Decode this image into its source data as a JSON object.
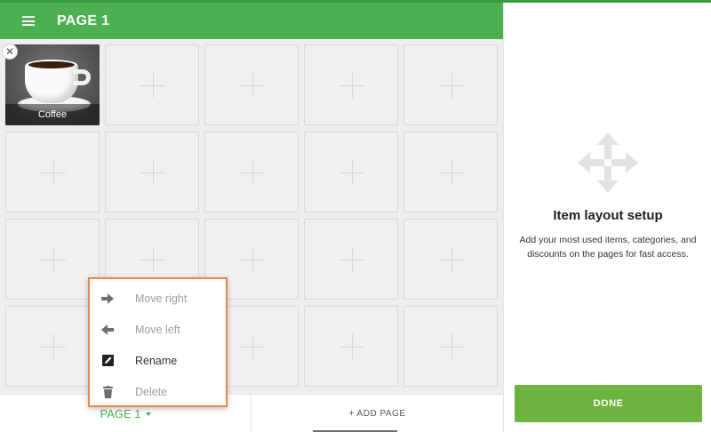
{
  "header": {
    "title": "PAGE 1",
    "menu_icon": "hamburger-menu-icon"
  },
  "grid": {
    "item": {
      "label": "Coffee",
      "remove_icon": "close-icon"
    },
    "empty_tile_icon": "plus-icon"
  },
  "context_menu": {
    "items": [
      {
        "label": "Move right",
        "icon": "arrow-right-icon",
        "enabled": false
      },
      {
        "label": "Move left",
        "icon": "arrow-left-icon",
        "enabled": false
      },
      {
        "label": "Rename",
        "icon": "edit-icon",
        "enabled": true
      },
      {
        "label": "Delete",
        "icon": "trash-icon",
        "enabled": false
      }
    ],
    "highlight_color": "#e8894a"
  },
  "bottom_bar": {
    "page_tab_label": "PAGE 1",
    "add_page_label": "+ ADD PAGE"
  },
  "right_panel": {
    "icon": "move-arrows-icon",
    "title": "Item layout setup",
    "description": "Add your most used items, categories, and discounts on the pages for fast access.",
    "done_label": "DONE"
  },
  "colors": {
    "app_bar": "#4caf50",
    "done_button": "#6cb43f",
    "accent_text": "#4caf50"
  }
}
